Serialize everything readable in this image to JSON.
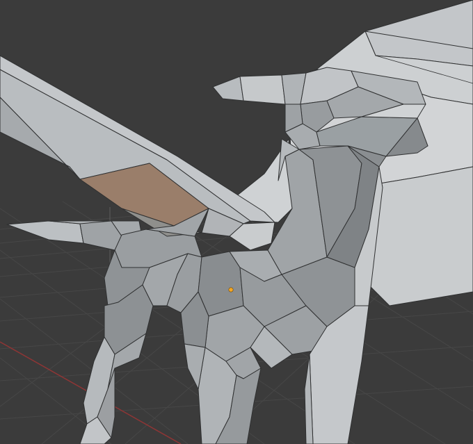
{
  "viewport": {
    "background": "#3b3b3b",
    "grid_color": "#464646",
    "x_axis_color": "#9c3a3a",
    "y_axis_color": "#6f8f3a",
    "origin_color": "#f5a623"
  },
  "model": {
    "type": "low-poly dragon mesh",
    "shading": "solid",
    "light_color": "#c9cccf",
    "mid_color": "#a7abae",
    "dark_color": "#808487",
    "edge_color": "#2e2f30"
  }
}
